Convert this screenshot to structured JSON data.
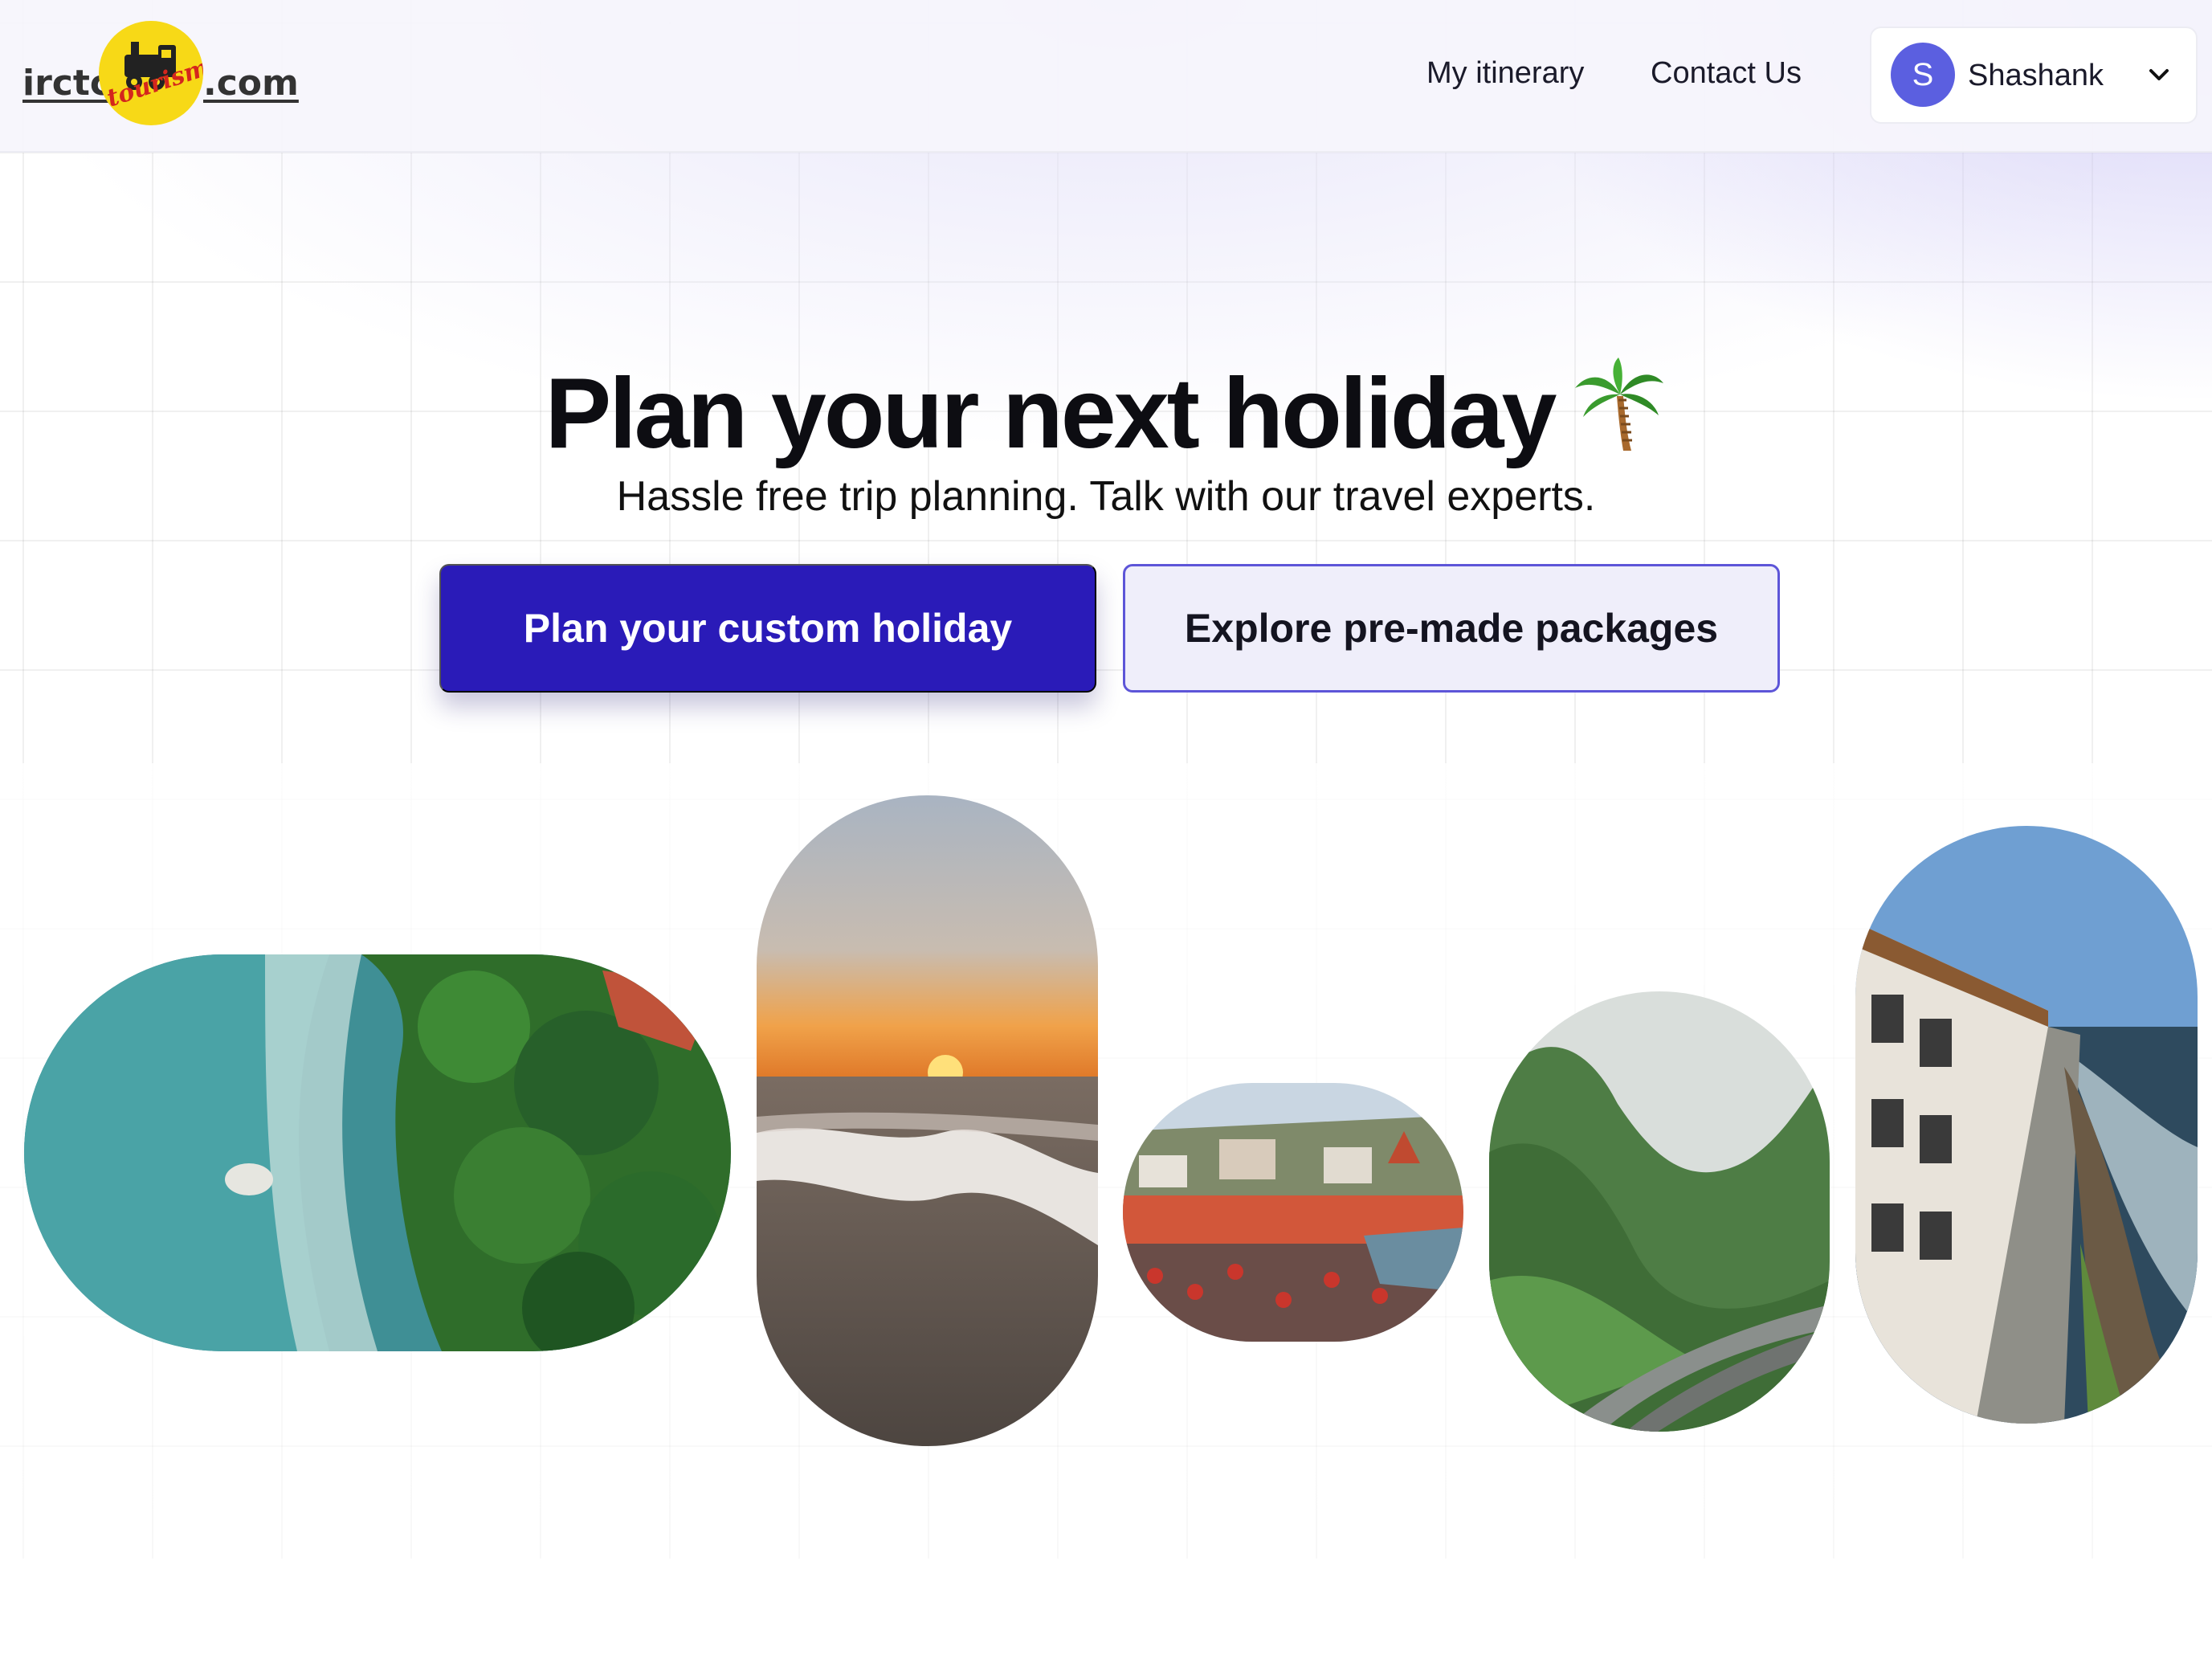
{
  "header": {
    "logo": {
      "left_text": "irctc",
      "right_text": ".com",
      "badge_text": "tourism"
    },
    "nav": [
      {
        "label": "My itinerary"
      },
      {
        "label": "Contact Us"
      }
    ],
    "user": {
      "initial": "S",
      "name": "Shashank",
      "dropdown_icon": "chevron-down-icon"
    }
  },
  "hero": {
    "title": "Plan your next holiday",
    "title_icon": "palm-tree-icon",
    "subtitle": "Hassle free trip planning. Talk with our travel experts.",
    "primary_button": "Plan your custom holiday",
    "secondary_button": "Explore pre-made packages"
  },
  "gallery": [
    {
      "subject": "aerial-coastline"
    },
    {
      "subject": "beach-sunset"
    },
    {
      "subject": "river-ghats"
    },
    {
      "subject": "green-valley-highway"
    },
    {
      "subject": "cliffside-resort"
    }
  ],
  "colors": {
    "primary": "#2a1bb8",
    "secondary_bg": "#efeefa",
    "secondary_border": "#5d55d8",
    "avatar": "#5b5fe0"
  }
}
